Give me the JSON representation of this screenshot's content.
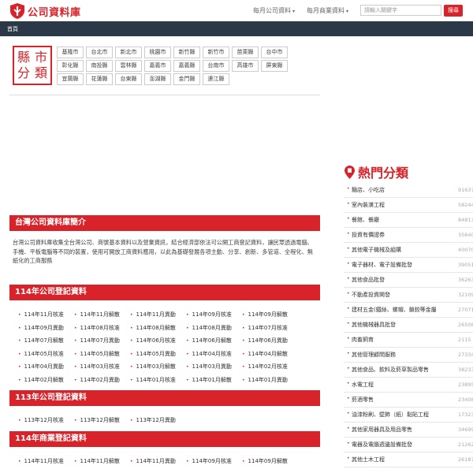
{
  "header": {
    "logo_text": "公司資料庫",
    "nav_monthly_company": "每月公司資料",
    "nav_monthly_business": "每月商業資料",
    "search_placeholder": "請輸入關鍵字",
    "search_button": "搜尋",
    "caret": "▾"
  },
  "breadcrumb": {
    "home": "首頁"
  },
  "county": {
    "badge_chars": [
      "縣",
      "市",
      "分",
      "類"
    ],
    "items": [
      "基隆市",
      "台北市",
      "新北市",
      "桃園市",
      "新竹縣",
      "新竹市",
      "苗栗縣",
      "台中市",
      "彰化縣",
      "南投縣",
      "雲林縣",
      "嘉義市",
      "嘉義縣",
      "台南市",
      "高雄市",
      "屏東縣",
      "宜蘭縣",
      "花蓮縣",
      "台東縣",
      "澎湖縣",
      "金門縣",
      "連江縣"
    ]
  },
  "intro": {
    "title": "台灣公司資料庫簡介",
    "body": "台灣公司資料庫收集全台灣公司、商號基本資料以及營業資訊，結合經濟部依法可公開工商登記資料，讓民眾透過電腦、手機、平板電腦等不同的裝置，使用可開放工商資料應用，以此為基礎發展各項主動、分享、創新、多管道、全程化、無紙化的工商服務"
  },
  "sections": [
    {
      "title": "114年公司登記資料",
      "links": [
        "114年11月核准",
        "114年11月解散",
        "114年11月異動",
        "114年09月核准",
        "114年09月解散",
        "114年09月異動",
        "114年08月核准",
        "114年08月解散",
        "114年08月異動",
        "114年07月核准",
        "114年07月解散",
        "114年07月異動",
        "114年06月核准",
        "114年06月解散",
        "114年06月異動",
        "114年05月核准",
        "114年05月解散",
        "114年05月異動",
        "114年04月核准",
        "114年04月解散",
        "114年04月異動",
        "114年03月核准",
        "114年03月解散",
        "114年03月異動",
        "114年02月核准",
        "114年02月解散",
        "114年02月異動",
        "114年01月核准",
        "114年01月解散",
        "114年01月異動"
      ]
    },
    {
      "title": "113年公司登記資料",
      "links": [
        "113年12月核准",
        "113年12月解散",
        "113年12月異動"
      ]
    },
    {
      "title": "114年商業登記資料",
      "links": [
        "114年11月核准",
        "114年11月解散",
        "114年11月異動",
        "114年09月核准",
        "114年09月解散"
      ]
    }
  ],
  "hot": {
    "title": "熱門分類",
    "items": [
      {
        "name": "麵店、小吃店",
        "count": "91637"
      },
      {
        "name": "室內裝潢工程",
        "count": "58244"
      },
      {
        "name": "餐館、餐廳",
        "count": "84813"
      },
      {
        "name": "投資有價證券",
        "count": "35640"
      },
      {
        "name": "其他電子機械及組購",
        "count": "40070"
      },
      {
        "name": "電子器材、電子設備批發",
        "count": "39051"
      },
      {
        "name": "其他食品批發",
        "count": "36263"
      },
      {
        "name": "不動產投資開發",
        "count": "32109"
      },
      {
        "name": "建材五金(鐵絲、螺帽、鎖鉸等金屬",
        "count": "27071"
      },
      {
        "name": "其他機械器具批發",
        "count": "26508"
      },
      {
        "name": "肉畜飼育",
        "count": "2115"
      },
      {
        "name": "其他管理顧問服務",
        "count": "27334"
      },
      {
        "name": "其他食品、飲料及菸草製品零售",
        "count": "38233"
      },
      {
        "name": "水電工程",
        "count": "23895"
      },
      {
        "name": "菸酒零售",
        "count": "23408"
      },
      {
        "name": "油漆粉刷、壁飾（紙）黏貼工程",
        "count": "17323"
      },
      {
        "name": "其他家用器具及用品零售",
        "count": "34699"
      },
      {
        "name": "電器及電腦週邊設備批發",
        "count": "21262"
      },
      {
        "name": "其他土木工程",
        "count": "26187"
      }
    ]
  },
  "colors": {
    "accent": "#d8232a",
    "nav_bar": "#2b3848"
  }
}
